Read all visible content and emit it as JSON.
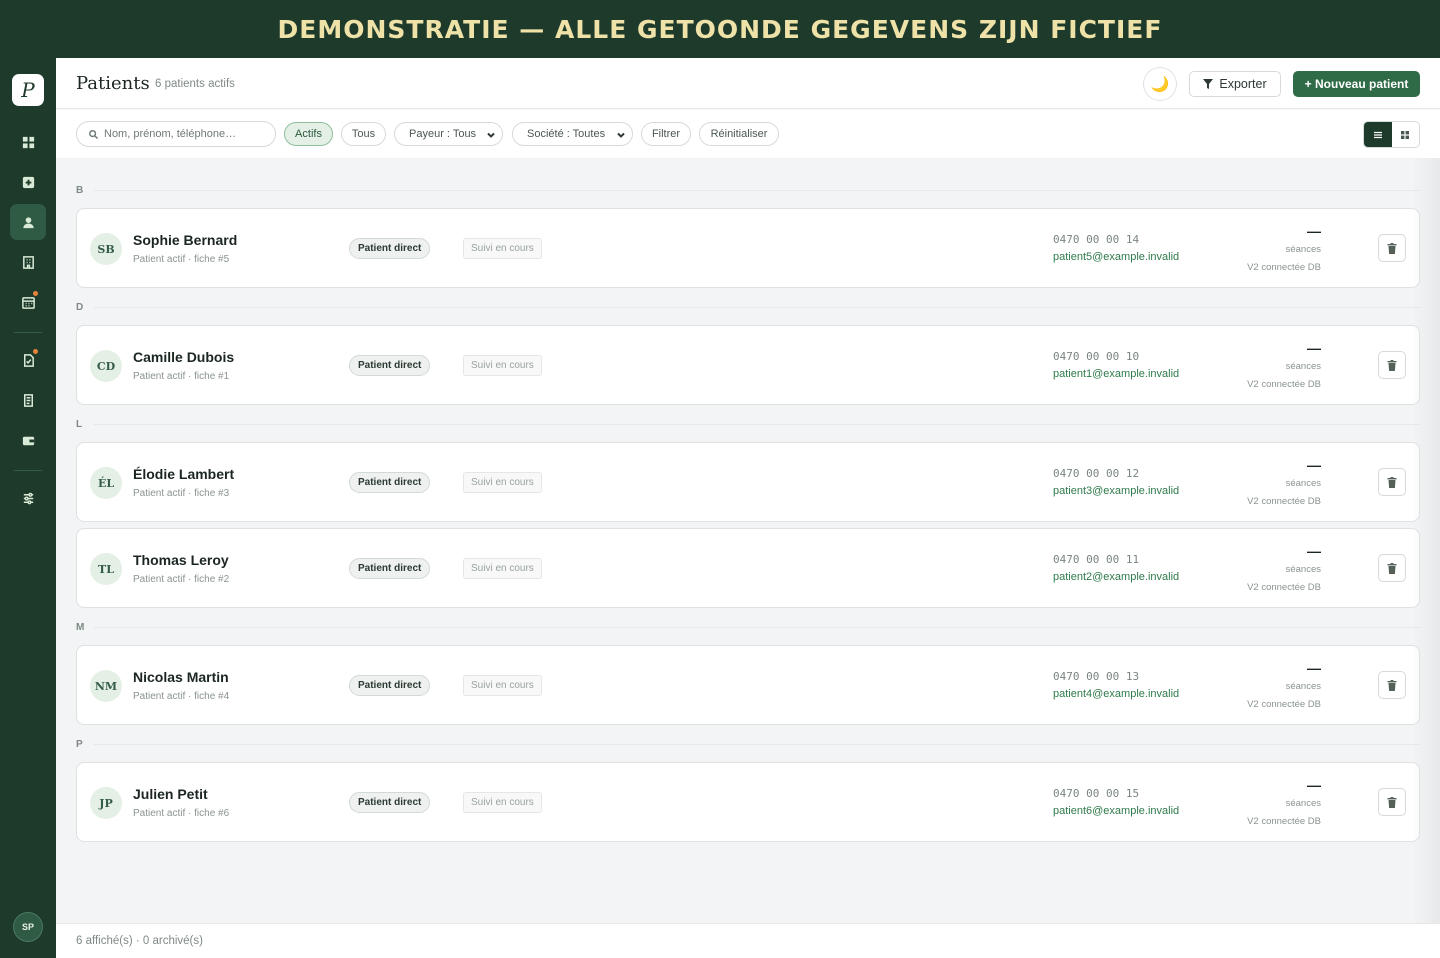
{
  "banner": {
    "text": "DEMONSTRATIE — ALLE GETOONDE GEGEVENS ZIJN FICTIEF"
  },
  "sidebar": {
    "logo": "P",
    "items": [
      {
        "icon": "dashboard-icon",
        "active": false,
        "badge": false
      },
      {
        "icon": "medical-plus-icon",
        "active": false,
        "badge": false
      },
      {
        "icon": "user-icon",
        "active": true,
        "badge": false
      },
      {
        "icon": "building-icon",
        "active": false,
        "badge": false
      },
      {
        "icon": "calendar-icon",
        "active": false,
        "badge": true
      },
      {
        "icon": "document-check-icon",
        "active": false,
        "badge": true
      },
      {
        "icon": "invoice-icon",
        "active": false,
        "badge": false
      },
      {
        "icon": "wallet-icon",
        "active": false,
        "badge": false
      },
      {
        "icon": "settings-sliders-icon",
        "active": false,
        "badge": false
      }
    ],
    "user_initials": "SP"
  },
  "header": {
    "title": "Patients",
    "subtitle": "6 patients actifs",
    "theme_icon": "🌙",
    "export_label": "Exporter",
    "new_label": "+ Nouveau patient"
  },
  "filters": {
    "search_placeholder": "Nom, prénom, téléphone…",
    "actifs": "Actifs",
    "tous": "Tous",
    "payeur": "Payeur : Tous",
    "societe": "Société : Toutes",
    "filtrer": "Filtrer",
    "reset": "Réinitialiser",
    "view_mode": "list"
  },
  "groups": [
    {
      "letter": "B"
    },
    {
      "letter": "D"
    },
    {
      "letter": "L"
    },
    {
      "letter": "M"
    },
    {
      "letter": "P"
    }
  ],
  "patients": [
    {
      "initials": "SB",
      "name": "Sophie Bernard",
      "sub": "Patient actif · fiche #5",
      "payer": "Patient direct",
      "status": "Suivi en cours",
      "phone": "0470 00 00 14",
      "email": "patient5@example.invalid",
      "sessions": "—",
      "sessions_label": "séances",
      "db": "V2 connectée DB"
    },
    {
      "initials": "CD",
      "name": "Camille Dubois",
      "sub": "Patient actif · fiche #1",
      "payer": "Patient direct",
      "status": "Suivi en cours",
      "phone": "0470 00 00 10",
      "email": "patient1@example.invalid",
      "sessions": "—",
      "sessions_label": "séances",
      "db": "V2 connectée DB"
    },
    {
      "initials": "ÉL",
      "name": "Élodie Lambert",
      "sub": "Patient actif · fiche #3",
      "payer": "Patient direct",
      "status": "Suivi en cours",
      "phone": "0470 00 00 12",
      "email": "patient3@example.invalid",
      "sessions": "—",
      "sessions_label": "séances",
      "db": "V2 connectée DB"
    },
    {
      "initials": "TL",
      "name": "Thomas Leroy",
      "sub": "Patient actif · fiche #2",
      "payer": "Patient direct",
      "status": "Suivi en cours",
      "phone": "0470 00 00 11",
      "email": "patient2@example.invalid",
      "sessions": "—",
      "sessions_label": "séances",
      "db": "V2 connectée DB"
    },
    {
      "initials": "NM",
      "name": "Nicolas Martin",
      "sub": "Patient actif · fiche #4",
      "payer": "Patient direct",
      "status": "Suivi en cours",
      "phone": "0470 00 00 13",
      "email": "patient4@example.invalid",
      "sessions": "—",
      "sessions_label": "séances",
      "db": "V2 connectée DB"
    },
    {
      "initials": "JP",
      "name": "Julien Petit",
      "sub": "Patient actif · fiche #6",
      "payer": "Patient direct",
      "status": "Suivi en cours",
      "phone": "0470 00 00 15",
      "email": "patient6@example.invalid",
      "sessions": "—",
      "sessions_label": "séances",
      "db": "V2 connectée DB"
    }
  ],
  "footer": {
    "text": "6 affiché(s) · 0 archivé(s)"
  },
  "colors": {
    "brand_dark": "#1e3a2b",
    "accent_green": "#2f6b47",
    "banner_text": "#efe2a8",
    "badge_orange": "#e8843a"
  }
}
